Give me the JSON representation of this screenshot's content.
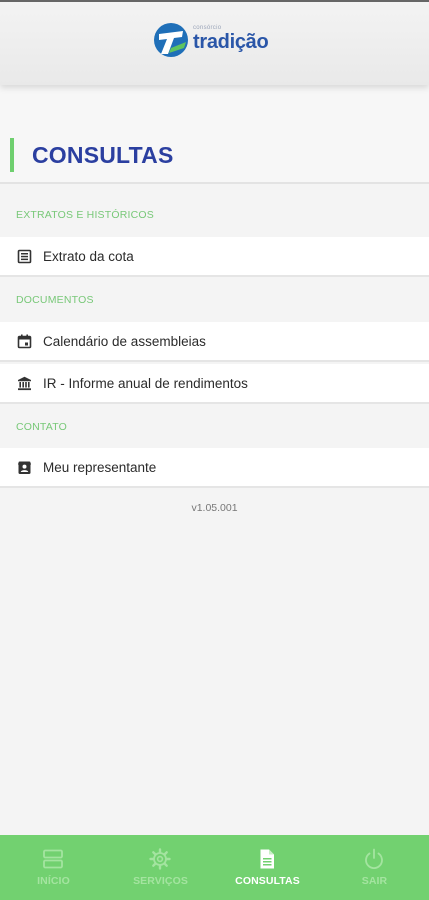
{
  "header": {
    "logo_small": "consórcio",
    "logo_text": "tradição",
    "brand_color": "#2a56a8"
  },
  "page": {
    "title": "CONSULTAS",
    "accent_color": "#6fcf6f"
  },
  "sections": [
    {
      "label": "EXTRATOS E HISTÓRICOS",
      "items": [
        {
          "label": "Extrato da cota",
          "icon": "list-icon"
        }
      ]
    },
    {
      "label": "DOCUMENTOS",
      "items": [
        {
          "label": "Calendário de assembleias",
          "icon": "calendar-icon"
        },
        {
          "label": "IR - Informe anual de rendimentos",
          "icon": "bank-icon"
        }
      ]
    },
    {
      "label": "CONTATO",
      "items": [
        {
          "label": "Meu representante",
          "icon": "contact-card-icon"
        }
      ]
    }
  ],
  "version": "v1.05.001",
  "bottom_nav": {
    "items": [
      {
        "label": "INÍCIO",
        "icon": "home-icon",
        "active": false
      },
      {
        "label": "SERVIÇOS",
        "icon": "gear-icon",
        "active": false
      },
      {
        "label": "CONSULTAS",
        "icon": "document-icon",
        "active": true
      },
      {
        "label": "SAIR",
        "icon": "power-icon",
        "active": false
      }
    ],
    "background_color": "#72d170"
  }
}
